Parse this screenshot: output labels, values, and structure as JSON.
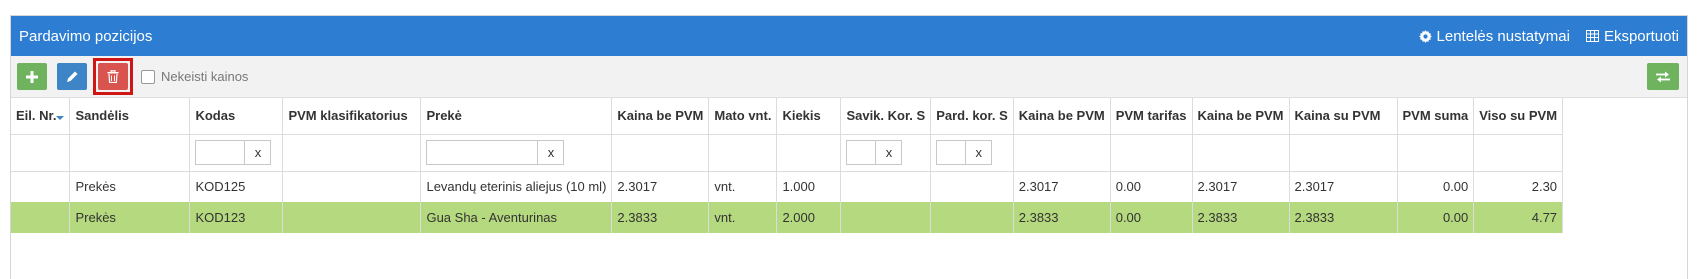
{
  "panel": {
    "title": "Pardavimo pozicijos",
    "settings_label": "Lentelės nustatymai",
    "export_label": "Eksportuoti"
  },
  "toolbar": {
    "checkbox_label": "Nekeisti kainos"
  },
  "colors": {
    "header_bg": "#2d7dd2",
    "add_button": "#6fb35f",
    "edit_button": "#3d85c6",
    "delete_button": "#d9534f",
    "selected_row": "#b5d97e",
    "highlight_border": "#d01515"
  },
  "icons": {
    "add": "plus-icon",
    "edit": "pencil-icon",
    "delete": "trash-icon",
    "settings": "gear-icon",
    "export": "table-icon",
    "swap": "swap-arrows-icon",
    "sort": "sort-icon"
  },
  "table": {
    "columns": [
      "Eil. Nr.",
      "Sandėlis",
      "Kodas",
      "PVM klasifikatorius",
      "Prekė",
      "Kaina be PVM",
      "Mato vnt.",
      "Kiekis",
      "Savik. Kor. S",
      "Pard. kor. S",
      "Kaina be PVM",
      "PVM tarifas",
      "Kaina be PVM",
      "Kaina su PVM",
      "PVM suma",
      "Viso su PVM"
    ],
    "filter_clear": "x",
    "rows": [
      {
        "nr": "",
        "warehouse": "Prekės",
        "code": "KOD125",
        "vat_class": "",
        "product": "Levandų eterinis aliejus (10 ml)",
        "price_ex_vat": "2.3017",
        "unit": "vnt.",
        "qty": "1.000",
        "cost": "",
        "sale": "",
        "price2": "2.3017",
        "vat_rate": "0.00",
        "price3": "2.3017",
        "price_vat": "2.3017",
        "vat_sum": "0.00",
        "total": "2.30"
      },
      {
        "nr": "",
        "warehouse": "Prekės",
        "code": "KOD123",
        "vat_class": "",
        "product": "Gua Sha - Aventurinas",
        "price_ex_vat": "2.3833",
        "unit": "vnt.",
        "qty": "2.000",
        "cost": "",
        "sale": "",
        "price2": "2.3833",
        "vat_rate": "0.00",
        "price3": "2.3833",
        "price_vat": "2.3833",
        "vat_sum": "0.00",
        "total": "4.77"
      }
    ]
  }
}
